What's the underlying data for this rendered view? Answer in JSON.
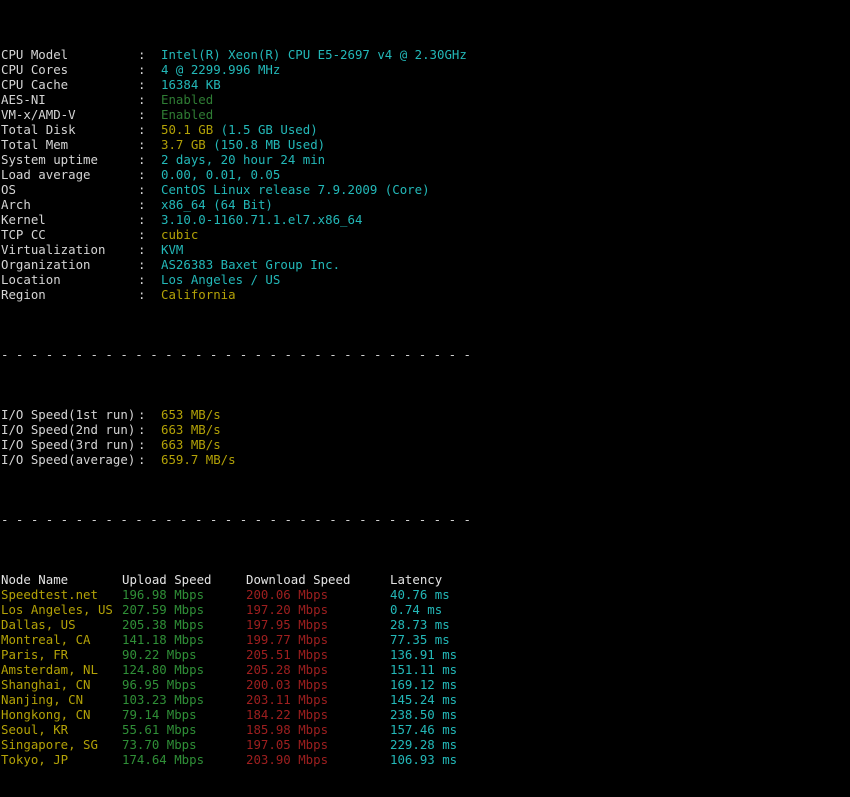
{
  "terminal": {
    "separator": "- - - - - - - - - - - - - - - - - - - - - - - - - - - - - - - -"
  },
  "system_info": [
    {
      "label": "CPU Model",
      "value": "Intel(R) Xeon(R) CPU E5-2697 v4 @ 2.30GHz",
      "color": "cyan"
    },
    {
      "label": "CPU Cores",
      "value": "4 @ 2299.996 MHz",
      "color": "cyan"
    },
    {
      "label": "CPU Cache",
      "value": "16384 KB",
      "color": "cyan"
    },
    {
      "label": "AES-NI",
      "value": "Enabled",
      "color": "dimgreen"
    },
    {
      "label": "VM-x/AMD-V",
      "value": "Enabled",
      "color": "dimgreen"
    },
    {
      "label": "Total Disk",
      "value": "50.1 GB",
      "value2": " (1.5 GB Used)",
      "color": "yellow",
      "color2": "cyan"
    },
    {
      "label": "Total Mem",
      "value": "3.7 GB",
      "value2": " (150.8 MB Used)",
      "color": "yellow",
      "color2": "cyan"
    },
    {
      "label": "System uptime",
      "value": "2 days, 20 hour 24 min",
      "color": "cyan"
    },
    {
      "label": "Load average",
      "value": "0.00, 0.01, 0.05",
      "color": "cyan"
    },
    {
      "label": "OS",
      "value": "CentOS Linux release 7.9.2009 (Core)",
      "color": "cyan"
    },
    {
      "label": "Arch",
      "value": "x86_64 (64 Bit)",
      "color": "cyan"
    },
    {
      "label": "Kernel",
      "value": "3.10.0-1160.71.1.el7.x86_64",
      "color": "cyan"
    },
    {
      "label": "TCP CC",
      "value": "cubic",
      "color": "yellow"
    },
    {
      "label": "Virtualization",
      "value": "KVM",
      "color": "cyan"
    },
    {
      "label": "Organization",
      "value": "AS26383 Baxet Group Inc.",
      "color": "cyan"
    },
    {
      "label": "Location",
      "value": "Los Angeles / US",
      "color": "cyan"
    },
    {
      "label": "Region",
      "value": "California",
      "color": "yellow"
    }
  ],
  "io_speed": [
    {
      "label": "I/O Speed(1st run)",
      "value": "653 MB/s"
    },
    {
      "label": "I/O Speed(2nd run)",
      "value": "663 MB/s"
    },
    {
      "label": "I/O Speed(3rd run)",
      "value": "663 MB/s"
    },
    {
      "label": "I/O Speed(average)",
      "value": "659.7 MB/s"
    }
  ],
  "speedtest": {
    "headers": {
      "node": "Node Name",
      "upload": "Upload Speed",
      "download": "Download Speed",
      "latency": "Latency"
    },
    "rows": [
      {
        "node": "Speedtest.net",
        "upload": "196.98 Mbps",
        "download": "200.06 Mbps",
        "latency": "40.76 ms"
      },
      {
        "node": "Los Angeles, US",
        "upload": "207.59 Mbps",
        "download": "197.20 Mbps",
        "latency": "0.74 ms"
      },
      {
        "node": "Dallas, US",
        "upload": "205.38 Mbps",
        "download": "197.95 Mbps",
        "latency": "28.73 ms"
      },
      {
        "node": "Montreal, CA",
        "upload": "141.18 Mbps",
        "download": "199.77 Mbps",
        "latency": "77.35 ms"
      },
      {
        "node": "Paris, FR",
        "upload": "90.22 Mbps",
        "download": "205.51 Mbps",
        "latency": "136.91 ms"
      },
      {
        "node": "Amsterdam, NL",
        "upload": "124.80 Mbps",
        "download": "205.28 Mbps",
        "latency": "151.11 ms"
      },
      {
        "node": "Shanghai, CN",
        "upload": "96.95 Mbps",
        "download": "200.03 Mbps",
        "latency": "169.12 ms"
      },
      {
        "node": "Nanjing, CN",
        "upload": "103.23 Mbps",
        "download": "203.11 Mbps",
        "latency": "145.24 ms"
      },
      {
        "node": "Hongkong, CN",
        "upload": "79.14 Mbps",
        "download": "184.22 Mbps",
        "latency": "238.50 ms"
      },
      {
        "node": "Seoul, KR",
        "upload": "55.61 Mbps",
        "download": "185.98 Mbps",
        "latency": "157.46 ms"
      },
      {
        "node": "Singapore, SG",
        "upload": "73.70 Mbps",
        "download": "197.05 Mbps",
        "latency": "229.28 ms"
      },
      {
        "node": "Tokyo, JP",
        "upload": "174.64 Mbps",
        "download": "203.90 Mbps",
        "latency": "106.93 ms"
      }
    ]
  }
}
